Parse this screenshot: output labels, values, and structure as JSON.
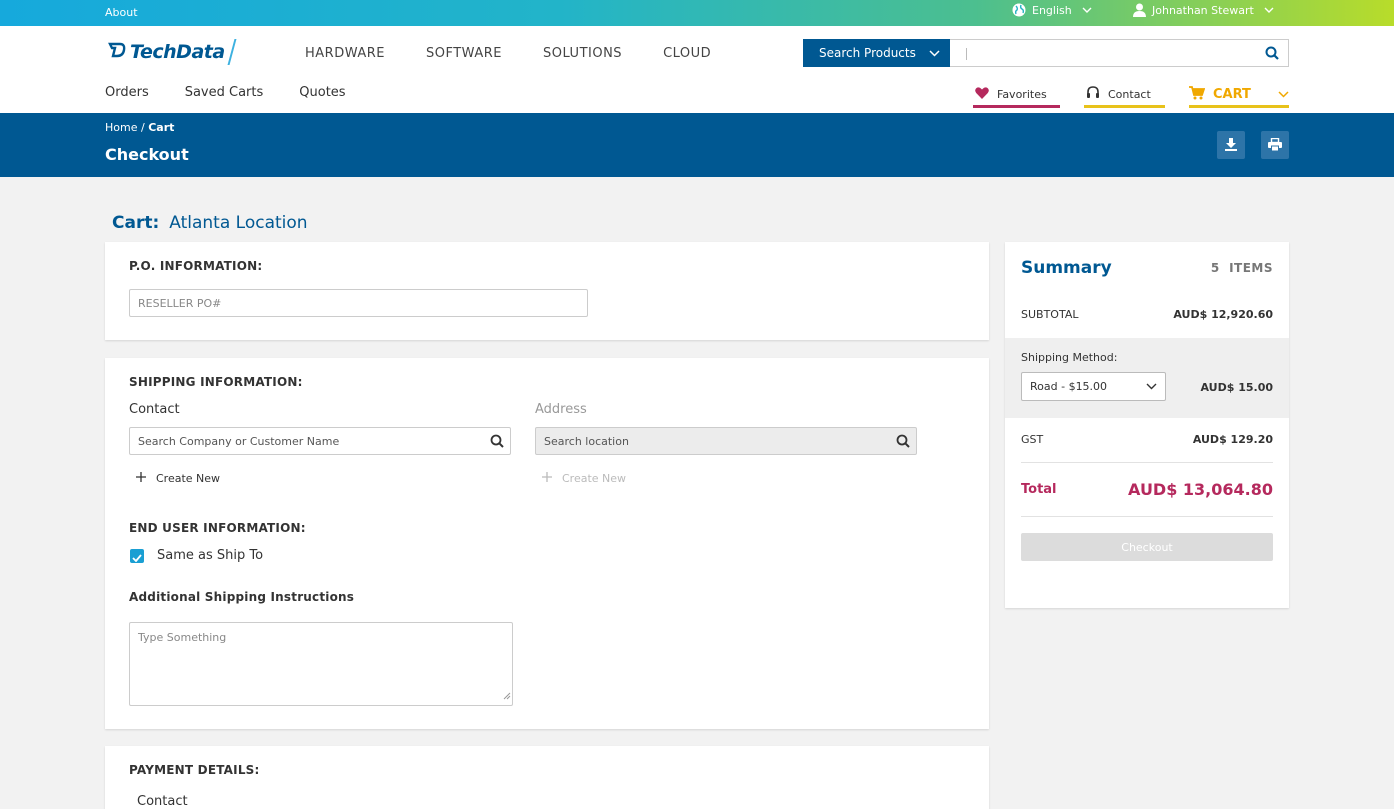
{
  "topbar": {
    "about": "About",
    "language": "English",
    "user": "Johnathan Stewart"
  },
  "header": {
    "logo": "TechData",
    "nav": [
      "HARDWARE",
      "SOFTWARE",
      "SOLUTIONS",
      "CLOUD"
    ],
    "search": {
      "scope": "Search Products",
      "value": "",
      "placeholder": ""
    },
    "subnav": [
      "Orders",
      "Saved Carts",
      "Quotes"
    ],
    "utilities": {
      "favorites": "Favorites",
      "contact": "Contact",
      "cart": "CART"
    }
  },
  "band": {
    "breadcrumb_home": "Home",
    "breadcrumb_sep": "/",
    "breadcrumb_current": "Cart",
    "title": "Checkout"
  },
  "cart": {
    "label": "Cart:",
    "name": "Atlanta Location"
  },
  "po": {
    "heading": "P.O. INFORMATION:",
    "placeholder": "RESELLER PO#"
  },
  "shipping": {
    "heading": "SHIPPING INFORMATION:",
    "contact_label": "Contact",
    "contact_placeholder": "Search Company or Customer Name",
    "address_label": "Address",
    "address_placeholder": "Search location",
    "create_new": "Create New",
    "end_user_heading": "END USER INFORMATION:",
    "same_as_ship_to": "Same as Ship To",
    "instructions_heading": "Additional Shipping Instructions",
    "instructions_placeholder": "Type Something"
  },
  "payment": {
    "heading": "PAYMENT DETAILS:",
    "contact_label": "Contact"
  },
  "summary": {
    "title": "Summary",
    "item_count": "5",
    "items_label": "ITEMS",
    "subtotal_label": "SUBTOTAL",
    "subtotal_value": "AUD$ 12,920.60",
    "shipping_method_label": "Shipping Method:",
    "shipping_method_selected": "Road - $15.00",
    "shipping_value": "AUD$ 15.00",
    "gst_label": "GST",
    "gst_value": "AUD$ 129.20",
    "total_label": "Total",
    "total_value": "AUD$ 13,064.80",
    "checkout_label": "Checkout"
  },
  "colors": {
    "brand_blue": "#005892",
    "accent_magenta": "#b5295d",
    "accent_yellow": "#e8c21a",
    "checkbox_blue": "#1a9fd3"
  }
}
